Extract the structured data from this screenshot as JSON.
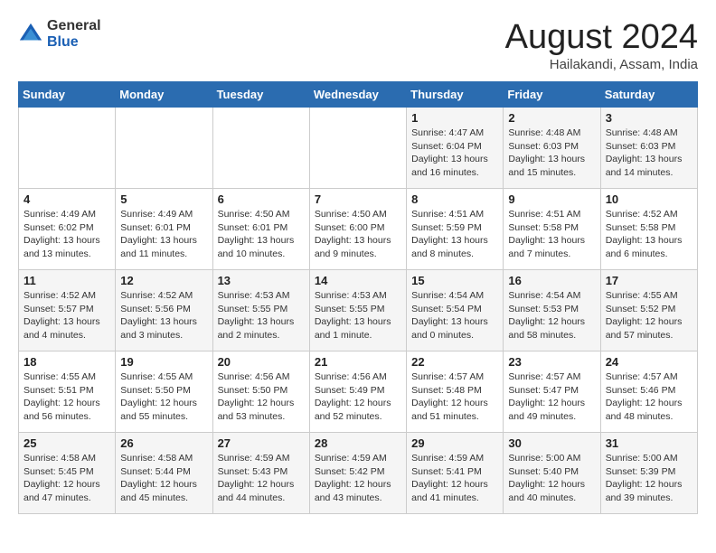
{
  "logo": {
    "general": "General",
    "blue": "Blue"
  },
  "header": {
    "month": "August 2024",
    "location": "Hailakandi, Assam, India"
  },
  "days_of_week": [
    "Sunday",
    "Monday",
    "Tuesday",
    "Wednesday",
    "Thursday",
    "Friday",
    "Saturday"
  ],
  "weeks": [
    [
      {
        "day": "",
        "info": ""
      },
      {
        "day": "",
        "info": ""
      },
      {
        "day": "",
        "info": ""
      },
      {
        "day": "",
        "info": ""
      },
      {
        "day": "1",
        "info": "Sunrise: 4:47 AM\nSunset: 6:04 PM\nDaylight: 13 hours\nand 16 minutes."
      },
      {
        "day": "2",
        "info": "Sunrise: 4:48 AM\nSunset: 6:03 PM\nDaylight: 13 hours\nand 15 minutes."
      },
      {
        "day": "3",
        "info": "Sunrise: 4:48 AM\nSunset: 6:03 PM\nDaylight: 13 hours\nand 14 minutes."
      }
    ],
    [
      {
        "day": "4",
        "info": "Sunrise: 4:49 AM\nSunset: 6:02 PM\nDaylight: 13 hours\nand 13 minutes."
      },
      {
        "day": "5",
        "info": "Sunrise: 4:49 AM\nSunset: 6:01 PM\nDaylight: 13 hours\nand 11 minutes."
      },
      {
        "day": "6",
        "info": "Sunrise: 4:50 AM\nSunset: 6:01 PM\nDaylight: 13 hours\nand 10 minutes."
      },
      {
        "day": "7",
        "info": "Sunrise: 4:50 AM\nSunset: 6:00 PM\nDaylight: 13 hours\nand 9 minutes."
      },
      {
        "day": "8",
        "info": "Sunrise: 4:51 AM\nSunset: 5:59 PM\nDaylight: 13 hours\nand 8 minutes."
      },
      {
        "day": "9",
        "info": "Sunrise: 4:51 AM\nSunset: 5:58 PM\nDaylight: 13 hours\nand 7 minutes."
      },
      {
        "day": "10",
        "info": "Sunrise: 4:52 AM\nSunset: 5:58 PM\nDaylight: 13 hours\nand 6 minutes."
      }
    ],
    [
      {
        "day": "11",
        "info": "Sunrise: 4:52 AM\nSunset: 5:57 PM\nDaylight: 13 hours\nand 4 minutes."
      },
      {
        "day": "12",
        "info": "Sunrise: 4:52 AM\nSunset: 5:56 PM\nDaylight: 13 hours\nand 3 minutes."
      },
      {
        "day": "13",
        "info": "Sunrise: 4:53 AM\nSunset: 5:55 PM\nDaylight: 13 hours\nand 2 minutes."
      },
      {
        "day": "14",
        "info": "Sunrise: 4:53 AM\nSunset: 5:55 PM\nDaylight: 13 hours\nand 1 minute."
      },
      {
        "day": "15",
        "info": "Sunrise: 4:54 AM\nSunset: 5:54 PM\nDaylight: 13 hours\nand 0 minutes."
      },
      {
        "day": "16",
        "info": "Sunrise: 4:54 AM\nSunset: 5:53 PM\nDaylight: 12 hours\nand 58 minutes."
      },
      {
        "day": "17",
        "info": "Sunrise: 4:55 AM\nSunset: 5:52 PM\nDaylight: 12 hours\nand 57 minutes."
      }
    ],
    [
      {
        "day": "18",
        "info": "Sunrise: 4:55 AM\nSunset: 5:51 PM\nDaylight: 12 hours\nand 56 minutes."
      },
      {
        "day": "19",
        "info": "Sunrise: 4:55 AM\nSunset: 5:50 PM\nDaylight: 12 hours\nand 55 minutes."
      },
      {
        "day": "20",
        "info": "Sunrise: 4:56 AM\nSunset: 5:50 PM\nDaylight: 12 hours\nand 53 minutes."
      },
      {
        "day": "21",
        "info": "Sunrise: 4:56 AM\nSunset: 5:49 PM\nDaylight: 12 hours\nand 52 minutes."
      },
      {
        "day": "22",
        "info": "Sunrise: 4:57 AM\nSunset: 5:48 PM\nDaylight: 12 hours\nand 51 minutes."
      },
      {
        "day": "23",
        "info": "Sunrise: 4:57 AM\nSunset: 5:47 PM\nDaylight: 12 hours\nand 49 minutes."
      },
      {
        "day": "24",
        "info": "Sunrise: 4:57 AM\nSunset: 5:46 PM\nDaylight: 12 hours\nand 48 minutes."
      }
    ],
    [
      {
        "day": "25",
        "info": "Sunrise: 4:58 AM\nSunset: 5:45 PM\nDaylight: 12 hours\nand 47 minutes."
      },
      {
        "day": "26",
        "info": "Sunrise: 4:58 AM\nSunset: 5:44 PM\nDaylight: 12 hours\nand 45 minutes."
      },
      {
        "day": "27",
        "info": "Sunrise: 4:59 AM\nSunset: 5:43 PM\nDaylight: 12 hours\nand 44 minutes."
      },
      {
        "day": "28",
        "info": "Sunrise: 4:59 AM\nSunset: 5:42 PM\nDaylight: 12 hours\nand 43 minutes."
      },
      {
        "day": "29",
        "info": "Sunrise: 4:59 AM\nSunset: 5:41 PM\nDaylight: 12 hours\nand 41 minutes."
      },
      {
        "day": "30",
        "info": "Sunrise: 5:00 AM\nSunset: 5:40 PM\nDaylight: 12 hours\nand 40 minutes."
      },
      {
        "day": "31",
        "info": "Sunrise: 5:00 AM\nSunset: 5:39 PM\nDaylight: 12 hours\nand 39 minutes."
      }
    ]
  ]
}
